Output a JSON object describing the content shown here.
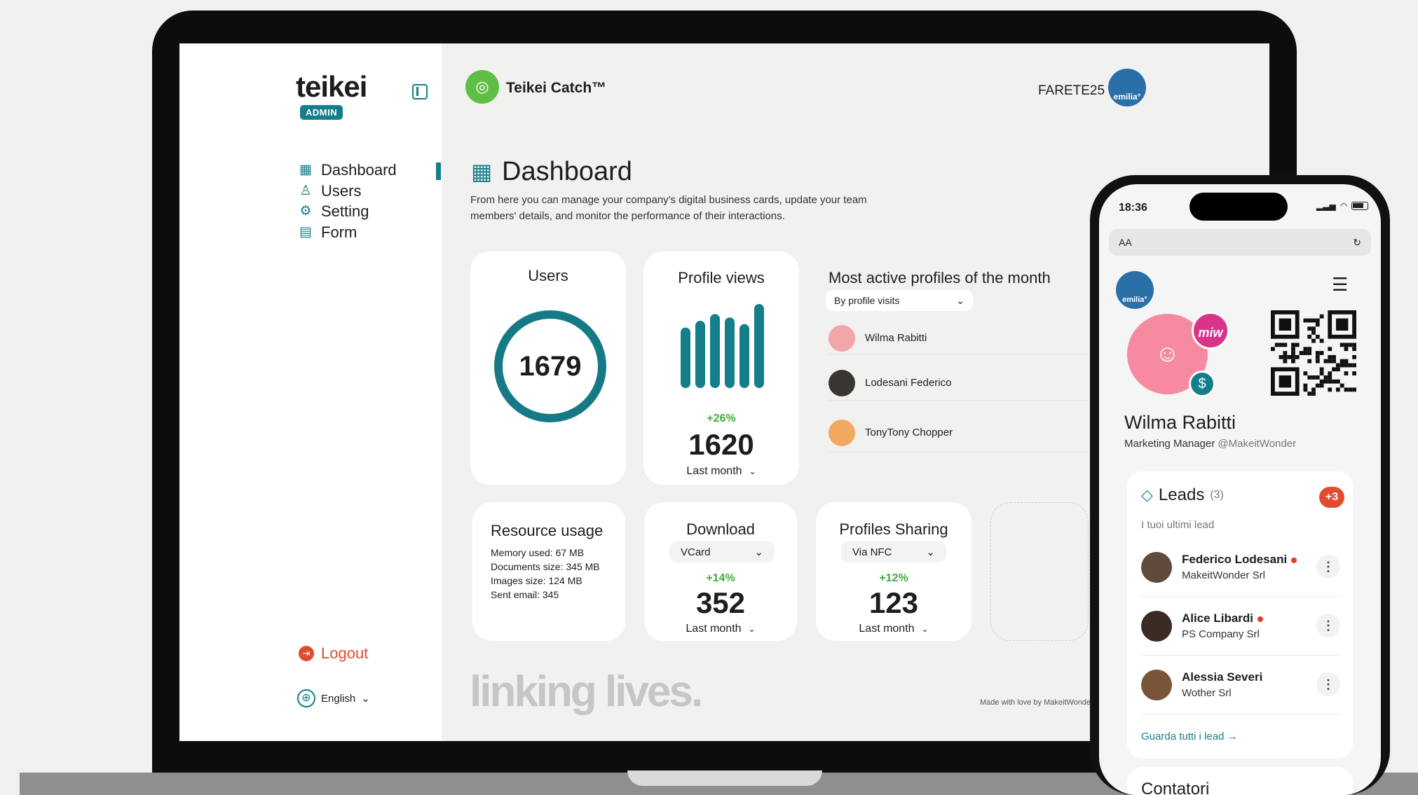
{
  "sidebar": {
    "logo_text": "teikei",
    "badge": "ADMIN",
    "nav": [
      {
        "label": "Dashboard",
        "icon": "grid-icon"
      },
      {
        "label": "Users",
        "icon": "user-icon"
      },
      {
        "label": "Setting",
        "icon": "gear-icon"
      },
      {
        "label": "Form",
        "icon": "form-icon"
      }
    ],
    "logout_label": "Logout",
    "language": "English"
  },
  "header": {
    "app_title": "Teikei Catch™",
    "username": "FARETE25",
    "avatar_text": "emilia°"
  },
  "main": {
    "title": "Dashboard",
    "intro": "From here you can manage your company's digital business cards, update your team members' details, and monitor the performance of their interactions.",
    "users_card": {
      "title": "Users",
      "value": "1679"
    },
    "views_card": {
      "title": "Profile views",
      "change": "+26%",
      "value": "1620",
      "period": "Last month",
      "bars": [
        0.72,
        0.8,
        0.88,
        0.84,
        0.76,
        1.0
      ]
    },
    "active_profiles": {
      "title": "Most active profiles of the month",
      "filter": "By profile visits",
      "profiles": [
        {
          "name": "Wilma Rabitti",
          "color": "#f2a6a6"
        },
        {
          "name": "Lodesani Federico",
          "color": "#3b3530"
        },
        {
          "name": "TonyTony Chopper",
          "color": "#f1a85f"
        }
      ]
    },
    "resource": {
      "title": "Resource usage",
      "memory": "Memory used: 67 MB",
      "documents": "Documents size: 345 MB",
      "images": "Images size: 124 MB",
      "email": "Sent email: 345"
    },
    "download": {
      "title": "Download",
      "filter": "VCard",
      "change": "+14%",
      "value": "352",
      "period": "Last month"
    },
    "sharing": {
      "title": "Profiles Sharing",
      "filter": "Via NFC",
      "change": "+12%",
      "value": "123",
      "period": "Last month"
    },
    "slogan": "linking lives.",
    "footer": "Made with love by MakeitWonde"
  },
  "phone": {
    "time": "18:36",
    "url_label": "AA",
    "logo_text": "emilia°",
    "badge_text": "miw",
    "name": "Wilma Rabitti",
    "role": "Marketing Manager",
    "handle": "@MakeitWonder",
    "leads": {
      "title": "Leads",
      "count": "(3)",
      "badge": "+3",
      "subtitle": "I tuoi ultimi lead",
      "items": [
        {
          "name": "Federico Lodesani",
          "company": "MakeitWonder Srl",
          "dot": true,
          "color": "#5f4a3c"
        },
        {
          "name": "Alice Libardi",
          "company": "PS Company Srl",
          "dot": true,
          "color": "#3a2b24"
        },
        {
          "name": "Alessia Severi",
          "company": "Wother Srl",
          "dot": false,
          "color": "#7a5438"
        }
      ],
      "more": "Guarda tutti i lead →"
    },
    "next_section": "Contatori"
  },
  "colors": {
    "accent": "#147e8a",
    "logout": "#e24b2f",
    "positive": "#3fae3a"
  }
}
